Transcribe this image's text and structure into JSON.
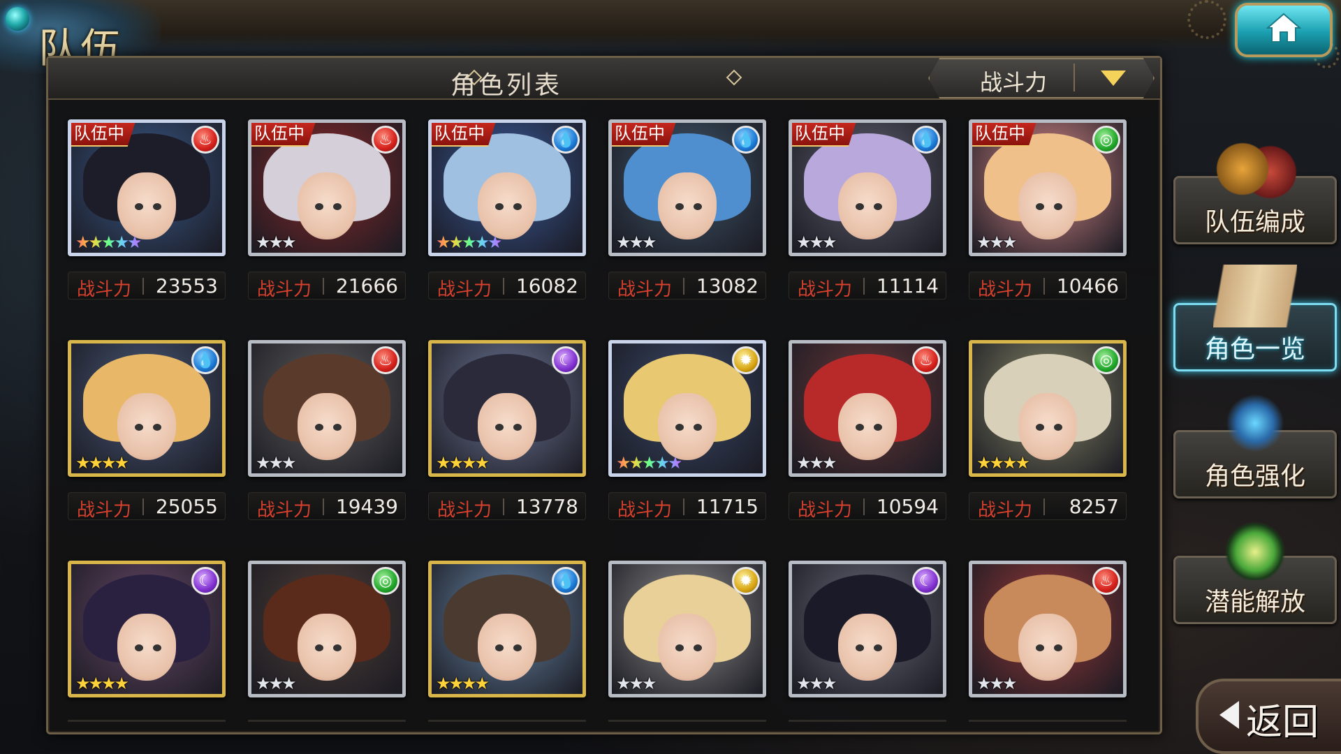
{
  "header": {
    "title": "队伍",
    "home_icon": "home-icon"
  },
  "panel": {
    "list_title": "角色列表",
    "sort": {
      "selected": "战斗力",
      "dropdown_icon": "triangle-down-icon"
    }
  },
  "power_label": "战斗力",
  "team_tag_label": "队伍中",
  "characters": [
    {
      "in_team": true,
      "element": "fire",
      "stars": 5,
      "frame": "rainbow",
      "power": "23553",
      "hair": "#1d1d2a",
      "bg": "#3a5a8a"
    },
    {
      "in_team": true,
      "element": "fire",
      "stars": 3,
      "frame": "silver",
      "power": "21666",
      "hair": "#d4cfd8",
      "bg": "#8a2a2a"
    },
    {
      "in_team": true,
      "element": "water",
      "stars": 5,
      "frame": "rainbow",
      "power": "16082",
      "hair": "#9fc0e0",
      "bg": "#3a5a9a"
    },
    {
      "in_team": true,
      "element": "water",
      "stars": 3,
      "frame": "silver",
      "power": "13082",
      "hair": "#4f8fcf",
      "bg": "#40566a"
    },
    {
      "in_team": true,
      "element": "water",
      "stars": 3,
      "frame": "silver",
      "power": "11114",
      "hair": "#b8a8dc",
      "bg": "#606070"
    },
    {
      "in_team": true,
      "element": "wind",
      "stars": 3,
      "frame": "silver",
      "power": "10466",
      "hair": "#f0c08a",
      "bg": "#d88a8a"
    },
    {
      "in_team": false,
      "element": "water",
      "stars": 4,
      "frame": "gold",
      "power": "25055",
      "hair": "#e8b868",
      "bg": "#4a5a7a"
    },
    {
      "in_team": false,
      "element": "fire",
      "stars": 3,
      "frame": "silver",
      "power": "19439",
      "hair": "#5a3a2a",
      "bg": "#606060"
    },
    {
      "in_team": false,
      "element": "dark",
      "stars": 4,
      "frame": "gold",
      "power": "13778",
      "hair": "#2a2a3a",
      "bg": "#707a9a"
    },
    {
      "in_team": false,
      "element": "light",
      "stars": 5,
      "frame": "rainbow",
      "power": "11715",
      "hair": "#e8c870",
      "bg": "#3a4a6a"
    },
    {
      "in_team": false,
      "element": "fire",
      "stars": 3,
      "frame": "silver",
      "power": "10594",
      "hair": "#b82a2a",
      "bg": "#6a3a3a"
    },
    {
      "in_team": false,
      "element": "wind",
      "stars": 4,
      "frame": "gold",
      "power": "8257",
      "hair": "#d8d0b8",
      "bg": "#8a8a6a"
    },
    {
      "in_team": false,
      "element": "dark",
      "stars": 4,
      "frame": "gold",
      "power": null,
      "hair": "#2a2040",
      "bg": "#6a4a6a"
    },
    {
      "in_team": false,
      "element": "wind",
      "stars": 3,
      "frame": "silver",
      "power": null,
      "hair": "#5a2a1a",
      "bg": "#504038"
    },
    {
      "in_team": false,
      "element": "water",
      "stars": 4,
      "frame": "gold",
      "power": null,
      "hair": "#4a3a30",
      "bg": "#6a8aaa"
    },
    {
      "in_team": false,
      "element": "light",
      "stars": 3,
      "frame": "silver",
      "power": null,
      "hair": "#e8d098",
      "bg": "#909090"
    },
    {
      "in_team": false,
      "element": "dark",
      "stars": 3,
      "frame": "silver",
      "power": null,
      "hair": "#1a1a28",
      "bg": "#6a6a7a"
    },
    {
      "in_team": false,
      "element": "fire",
      "stars": 3,
      "frame": "silver",
      "power": null,
      "hair": "#c88a5a",
      "bg": "#9a3a3a"
    }
  ],
  "side_menu": [
    {
      "label": "队伍编成",
      "icon": "party-members-icon",
      "active": false
    },
    {
      "label": "角色一览",
      "icon": "open-book-icon",
      "active": true
    },
    {
      "label": "角色强化",
      "icon": "card-upgrade-icon",
      "active": false
    },
    {
      "label": "潜能解放",
      "icon": "potential-orb-icon",
      "active": false
    }
  ],
  "back_button": {
    "label": "返回",
    "icon": "back-arrow-icon"
  },
  "colors": {
    "fire": "#d4201b",
    "water": "#1b78d4",
    "wind": "#22a72a",
    "dark": "#8030d0",
    "light": "#d8a614",
    "power_label": "#d8402e",
    "team_tag": "#c8281e",
    "active_accent": "#3fc6e6"
  }
}
